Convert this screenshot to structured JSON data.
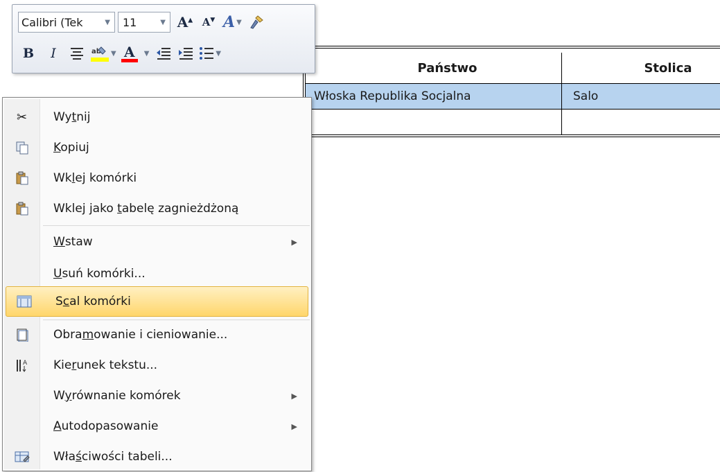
{
  "mini_toolbar": {
    "font_name": "Calibri (Tek",
    "font_size": "11",
    "icons": {
      "grow_font": "grow-font-icon",
      "shrink_font": "shrink-font-icon",
      "styles": "styles-icon",
      "format_painter": "format-painter-icon",
      "bold": "bold-icon",
      "italic": "italic-icon",
      "center": "center-align-icon",
      "highlight": "highlight-icon",
      "font_color": "font-color-icon",
      "decrease_indent": "decrease-indent-icon",
      "increase_indent": "increase-indent-icon",
      "bullets": "bullets-icon"
    },
    "glyphs": {
      "bold": "B",
      "italic": "I",
      "font_color": "A",
      "grow": "A",
      "shrink": "A",
      "styles": "A"
    },
    "colors": {
      "highlight": "#ffff00",
      "font_color": "#ff0000"
    }
  },
  "table": {
    "headers": [
      "Państwo",
      "Stolica"
    ],
    "rows": [
      [
        "Włoska Republika Socjalna",
        "Salo"
      ],
      [
        "",
        ""
      ]
    ],
    "selected_row_color": "#b7d3ef"
  },
  "context_menu": {
    "items": [
      {
        "pre": "Wy",
        "u": "t",
        "post": "nij",
        "icon": "scissors-icon"
      },
      {
        "pre": "",
        "u": "K",
        "post": "opiuj",
        "icon": "copy-icon"
      },
      {
        "pre": "Wk",
        "u": "l",
        "post": "ej komórki",
        "icon": "paste-icon"
      },
      {
        "pre": "Wklej jako ",
        "u": "t",
        "post": "abelę zagnieżdżoną",
        "icon": "paste-nested-icon"
      },
      {
        "pre": "",
        "u": "W",
        "post": "staw"
      },
      {
        "pre": "",
        "u": "U",
        "post": "suń komórki..."
      },
      {
        "pre": "S",
        "u": "c",
        "post": "al komórki",
        "icon": "merge-cells-icon"
      },
      {
        "pre": "Obra",
        "u": "m",
        "post": "owanie i cieniowanie...",
        "icon": "borders-icon"
      },
      {
        "pre": "Kie",
        "u": "r",
        "post": "unek tekstu...",
        "icon": "text-direction-icon"
      },
      {
        "pre": "W",
        "u": "y",
        "post": "równanie komórek"
      },
      {
        "pre": "",
        "u": "A",
        "post": "utodopasowanie"
      },
      {
        "pre": "Wła",
        "u": "ś",
        "post": "ciwości tabeli...",
        "icon": "table-properties-icon"
      }
    ],
    "highlight_color": "#ffd66b"
  }
}
